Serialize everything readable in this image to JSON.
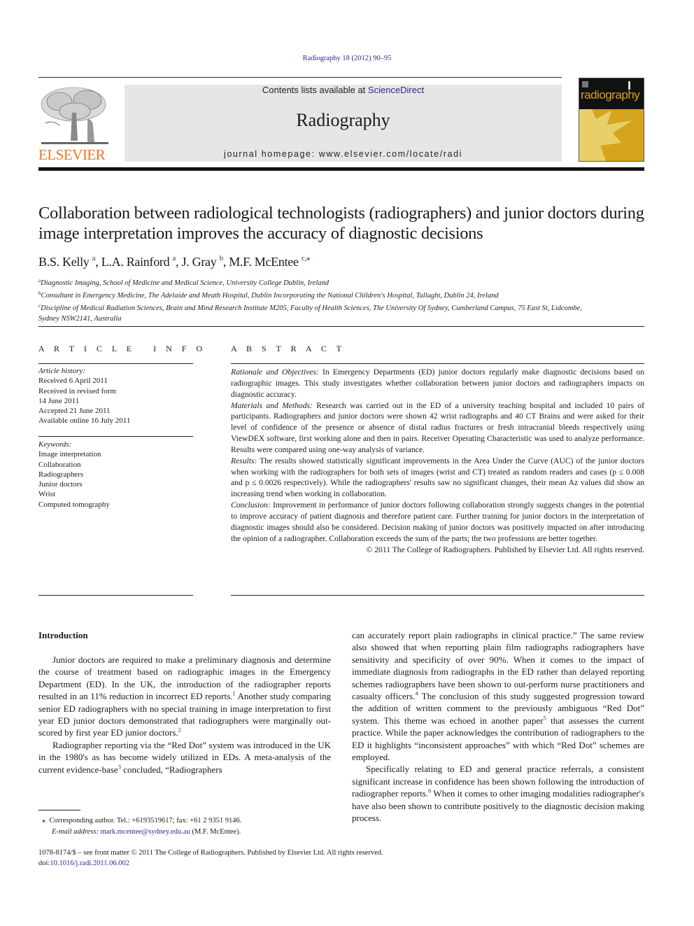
{
  "citation": "Radiography 18 (2012) 90–95",
  "header": {
    "publisher_logo_text": "ELSEVIER",
    "contents_prefix": "Contents lists available at ",
    "contents_link": "ScienceDirect",
    "journal_name": "Radiography",
    "homepage": "journal homepage: www.elsevier.com/locate/radi",
    "cover_title": "radiography",
    "colors": {
      "elsevier_orange": "#e87722",
      "link_blue": "#2a2a8a",
      "cover_gold": "#d4a51c",
      "cover_light": "#e8cf6a",
      "cover_black": "#111111",
      "masthead_gray": "#e6e6e6"
    }
  },
  "article": {
    "title": "Collaboration between radiological technologists (radiographers) and junior doctors during image interpretation improves the accuracy of diagnostic decisions",
    "authors": [
      {
        "name": "B.S. Kelly",
        "sup": "a"
      },
      {
        "name": "L.A. Rainford",
        "sup": "a"
      },
      {
        "name": "J. Gray",
        "sup": "b"
      },
      {
        "name": "M.F. McEntee",
        "sup": "c,⁎"
      }
    ],
    "affiliations": [
      {
        "sup": "a",
        "text": "Diagnostic Imaging, School of Medicine and Medical Science, University College Dublin, Ireland"
      },
      {
        "sup": "b",
        "text": "Consultant in Emergency Medicine, The Adelaide and Meath Hospital, Dublin Incorporating the National Children's Hospital, Tallaght, Dublin 24, Ireland"
      },
      {
        "sup": "c",
        "text": "Discipline of Medical Radiation Sciences, Brain and Mind Research Institute M205, Faculty of Health Sciences, The University Of Sydney, Cumberland Campus, 75 East St, Lidcombe, Sydney NSW2141, Australia"
      }
    ]
  },
  "article_info": {
    "heading": "A R T I C L E   I N F O",
    "history_label": "Article history:",
    "history": [
      "Received 6 April 2011",
      "Received in revised form",
      "14 June 2011",
      "Accepted 21 June 2011",
      "Available online 16 July 2011"
    ],
    "keywords_label": "Keywords:",
    "keywords": [
      "Image interpretation",
      "Collaboration",
      "Radiographers",
      "Junior doctors",
      "Wrist",
      "Computed tomography"
    ]
  },
  "abstract": {
    "heading": "A B S T R A C T",
    "sections": [
      {
        "label": "Rationale and Objectives:",
        "text": " In Emergency Departments (ED) junior doctors regularly make diagnostic decisions based on radiographic images. This study investigates whether collaboration between junior doctors and radiographers impacts on diagnostic accuracy."
      },
      {
        "label": "Materials and Methods:",
        "text": " Research was carried out in the ED of a university teaching hospital and included 10 pairs of participants. Radiographers and junior doctors were shown 42 wrist radiographs and 40 CT Brains and were asked for their level of confidence of the presence or absence of distal radius fractures or fresh intracranial bleeds respectively using ViewDEX software, first working alone and then in pairs. Receiver Operating Characteristic was used to analyze performance. Results were compared using one-way analysis of variance."
      },
      {
        "label": "Results:",
        "text": " The results showed statistically significant improvements in the Area Under the Curve (AUC) of the junior doctors when working with the radiographers for both sets of images (wrist and CT) treated as random readers and cases (p ≤ 0.008 and p ≤ 0.0026 respectively). While the radiographers' results saw no significant changes, their mean Az values did show an increasing trend when working in collaboration."
      },
      {
        "label": "Conclusion:",
        "text": " Improvement in performance of junior doctors following collaboration strongly suggests changes in the potential to improve accuracy of patient diagnosis and therefore patient care. Further training for junior doctors in the interpretation of diagnostic images should also be considered. Decision making of junior doctors was positively impacted on after introducing the opinion of a radiographer. Collaboration exceeds the sum of the parts; the two professions are better together."
      }
    ],
    "copyright": "© 2011 The College of Radiographers. Published by Elsevier Ltd. All rights reserved."
  },
  "body": {
    "intro_heading": "Introduction",
    "left": [
      {
        "parts": [
          "Junior doctors are required to make a preliminary diagnosis and determine the course of treatment based on radiographic images in the Emergency Department (ED). In the UK, the introduction of the radiographer reports resulted in an 11% reduction in incorrect ED reports.",
          "1",
          " Another study comparing senior ED radiographers with no special training in image interpretation to first year ED junior doctors demonstrated that radiographers were marginally out-scored by first year ED junior doctors.",
          "2",
          ""
        ]
      },
      {
        "parts": [
          "Radiographer reporting via the “Red Dot” system was introduced in the UK in the 1980's as has become widely utilized in EDs. A meta-analysis of the current evidence-base",
          "3",
          " concluded, “Radiographers"
        ]
      }
    ],
    "right": [
      {
        "parts": [
          "can accurately report plain radiographs in clinical practice.” The same review also showed that when reporting plain film radiographs radiographers have sensitivity and specificity of over 90%. When it comes to the impact of immediate diagnosis from radiographs in the ED rather than delayed reporting schemes radiographers have been shown to out-perform nurse practitioners and casualty officers.",
          "4",
          " The conclusion of this study suggested progression toward the addition of written comment to the previously ambiguous “Red Dot” system. This theme was echoed in another paper",
          "5",
          " that assesses the current practice. While the paper acknowledges the contribution of radiographers to the ED it highlights “inconsistent approaches” with which “Red Dot” schemes are employed."
        ]
      },
      {
        "parts": [
          "Specifically relating to ED and general practice referrals, a consistent significant increase in confidence has been shown following the introduction of radiographer reports.",
          "6",
          " When it comes to other imaging modalities radiographer's have also been shown to contribute positively to the diagnostic decision making process."
        ]
      }
    ]
  },
  "footnote": {
    "marker": "⁎",
    "corresponding": "Corresponding author. Tel.: +6193519617; fax: +61 2 9351 9146.",
    "email_label": "E-mail address:",
    "email": "mark.mcentee@sydney.edu.au",
    "email_suffix": " (M.F. McEntee)."
  },
  "bottom": {
    "front_matter": "1078-8174/$ – see front matter © 2011 The College of Radiographers. Published by Elsevier Ltd. All rights reserved.",
    "doi_prefix": "doi:",
    "doi": "10.1016/j.radi.2011.06.002"
  }
}
